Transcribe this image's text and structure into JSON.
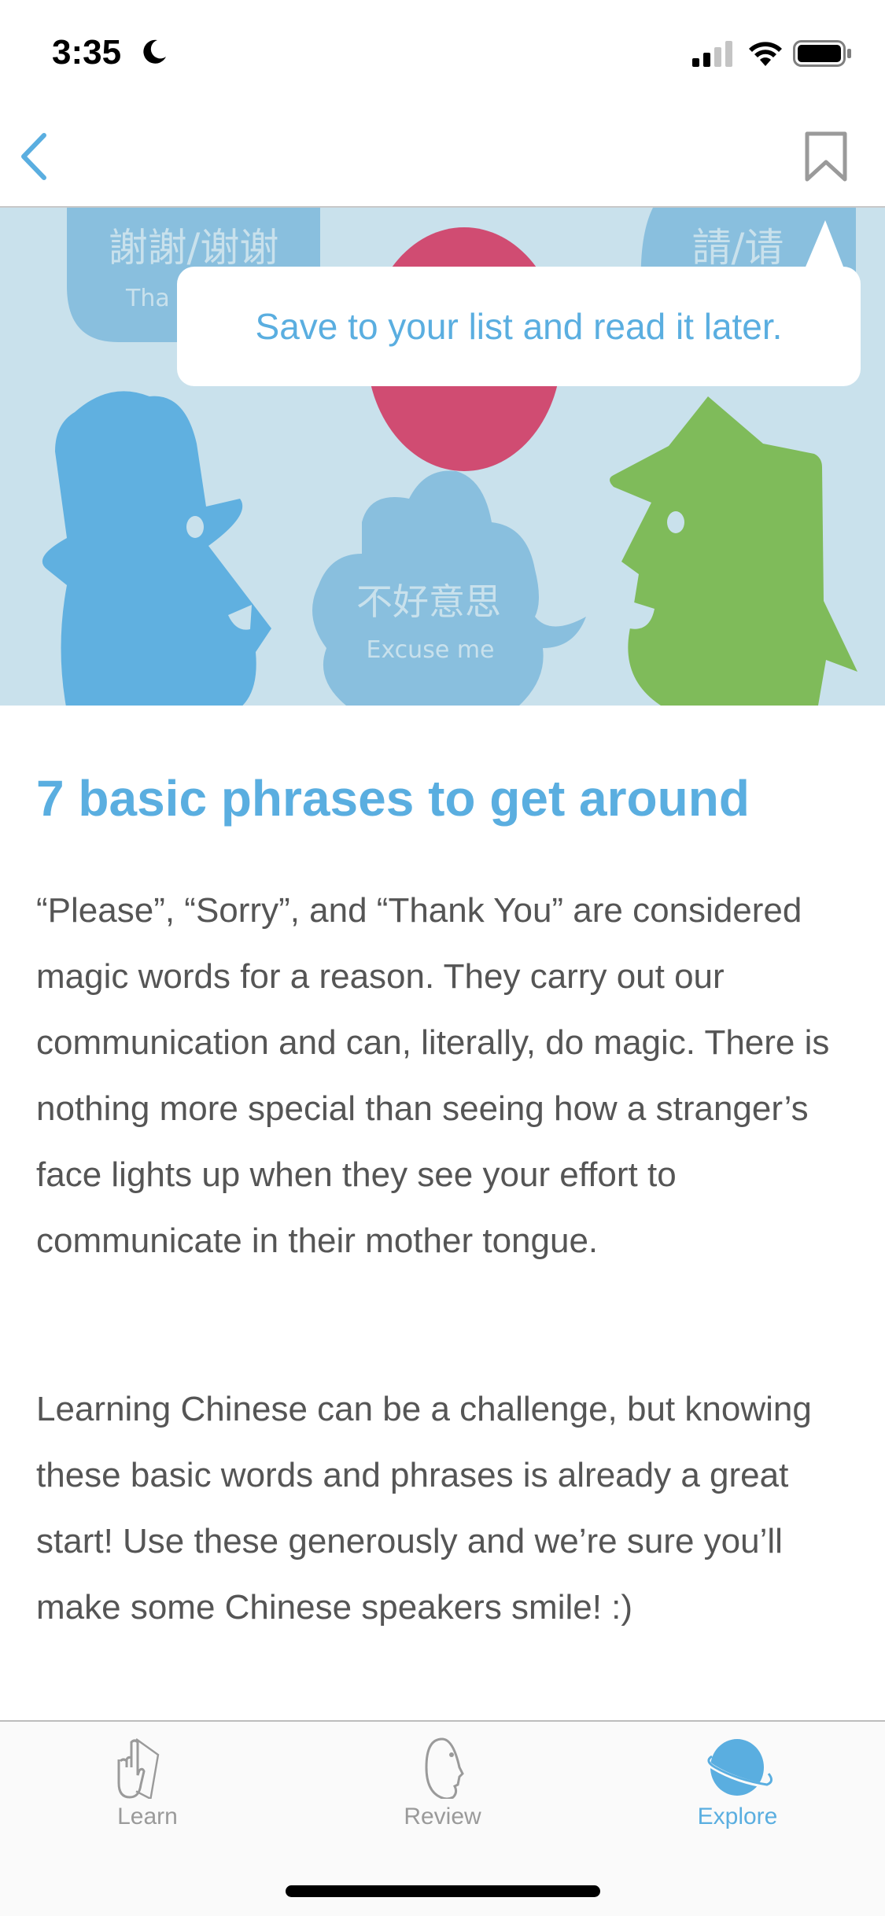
{
  "status_bar": {
    "time": "3:35",
    "icons": [
      "moon-icon",
      "cellular-signal-icon",
      "wifi-icon",
      "battery-icon"
    ]
  },
  "nav": {
    "back_icon": "chevron-left-icon",
    "bookmark_icon": "bookmark-icon"
  },
  "hero": {
    "bubble_thanks": {
      "chinese": "謝謝/谢谢",
      "english": "Tha"
    },
    "bubble_please": {
      "chinese": "請/请"
    },
    "bubble_excuse": {
      "chinese": "不好意思",
      "english": "Excuse me"
    }
  },
  "tooltip": {
    "text": "Save to your list and read it later."
  },
  "article": {
    "title": "7 basic phrases to get around",
    "paragraphs": [
      "“Please”, “Sorry”, and “Thank You” are considered magic words for a reason. They carry out our communication and can, literally, do magic. There is nothing more special than seeing how a stranger’s face lights up when they see your effort to communicate in their mother tongue.",
      "Learning Chinese can be a challenge, but knowing these basic words and phrases is already a great start! Use these generously and we’re sure you’ll make some Chinese speakers smile! :)"
    ]
  },
  "tabbar": {
    "tabs": [
      {
        "label": "Learn",
        "icon": "hand-card-icon",
        "active": false
      },
      {
        "label": "Review",
        "icon": "face-profile-icon",
        "active": false
      },
      {
        "label": "Explore",
        "icon": "planet-icon",
        "active": true
      }
    ]
  },
  "colors": {
    "accent": "#5aaee0",
    "hero_bg": "#c9e1ec",
    "green": "#7fbb5a",
    "red": "#d04c72"
  }
}
